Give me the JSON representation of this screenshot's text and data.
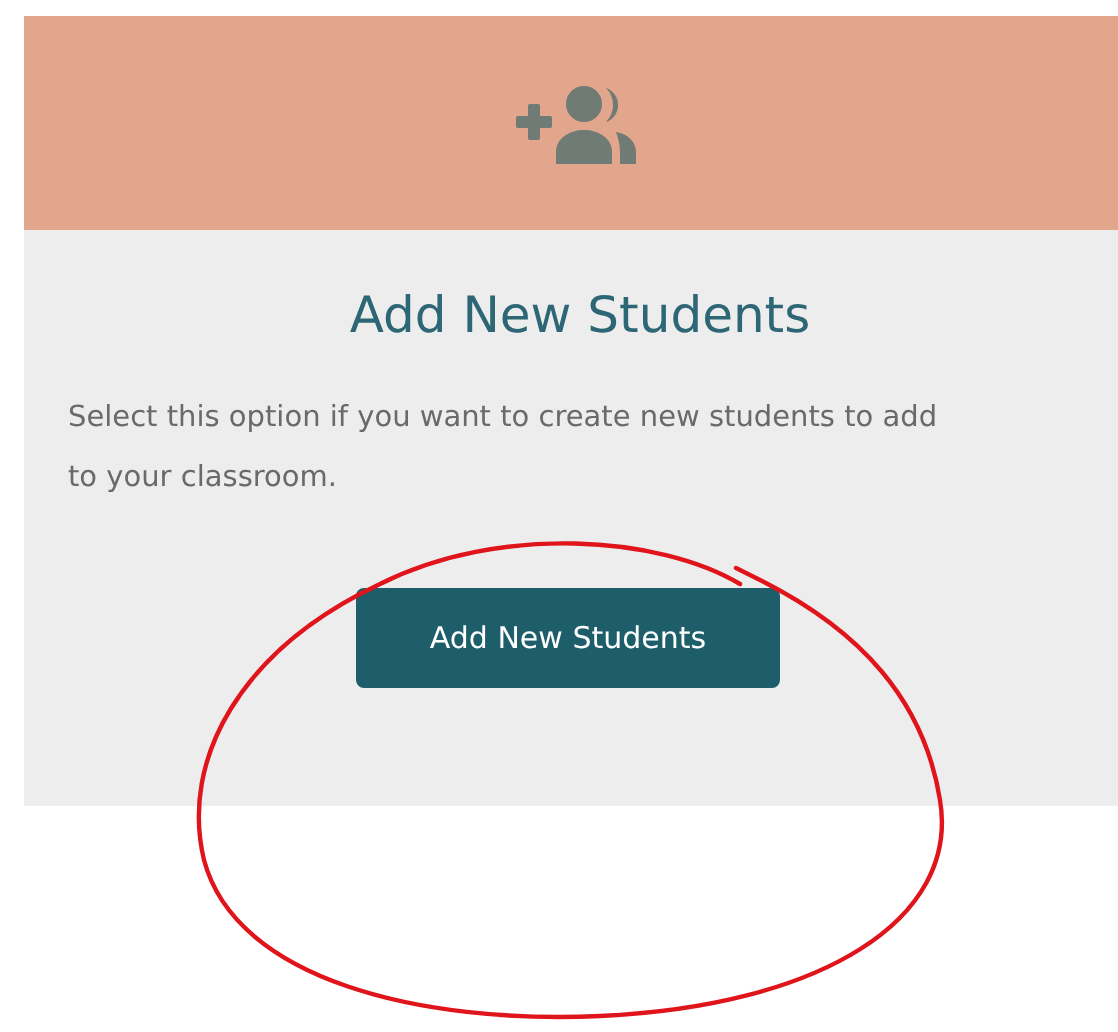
{
  "card": {
    "title": "Add New Students",
    "description": "Select this option if you want to create new students to add to your classroom.",
    "button": "Add New Students"
  }
}
